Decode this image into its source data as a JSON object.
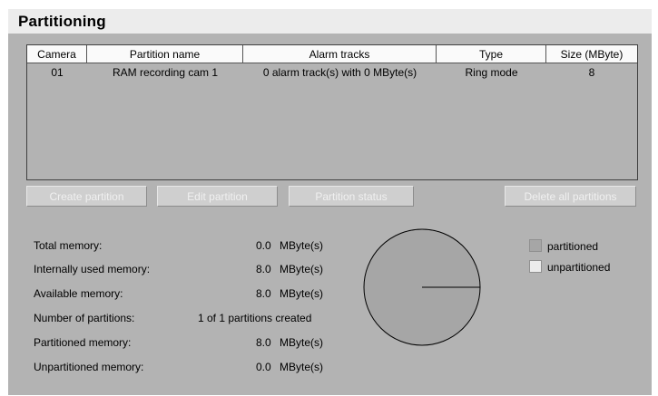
{
  "title": "Partitioning",
  "table": {
    "headers": [
      "Camera",
      "Partition name",
      "Alarm tracks",
      "Type",
      "Size (MByte)"
    ],
    "rows": [
      [
        "01",
        "RAM recording cam 1",
        "0 alarm track(s) with 0 MByte(s)",
        "Ring mode",
        "8"
      ]
    ]
  },
  "buttons": {
    "create": "Create partition",
    "edit": "Edit partition",
    "status": "Partition status",
    "delete_all": "Delete all partitions"
  },
  "stats": [
    {
      "label": "Total memory:",
      "value": "0.0",
      "unit": "MByte(s)"
    },
    {
      "label": "Internally used memory:",
      "value": "8.0",
      "unit": "MByte(s)"
    },
    {
      "label": "Available memory:",
      "value": "8.0",
      "unit": "MByte(s)"
    },
    {
      "label": "Number of partitions:",
      "value": "1 of 1 partitions created",
      "unit": ""
    },
    {
      "label": "Partitioned memory:",
      "value": "8.0",
      "unit": "MByte(s)"
    },
    {
      "label": "Unpartitioned memory:",
      "value": "0.0",
      "unit": "MByte(s)"
    }
  ],
  "legend": {
    "partitioned": "partitioned",
    "unpartitioned": "unpartitioned"
  },
  "colors": {
    "panel_bg": "#b3b3b3",
    "partitioned": "#a6a6a6",
    "unpartitioned": "#ececec"
  }
}
